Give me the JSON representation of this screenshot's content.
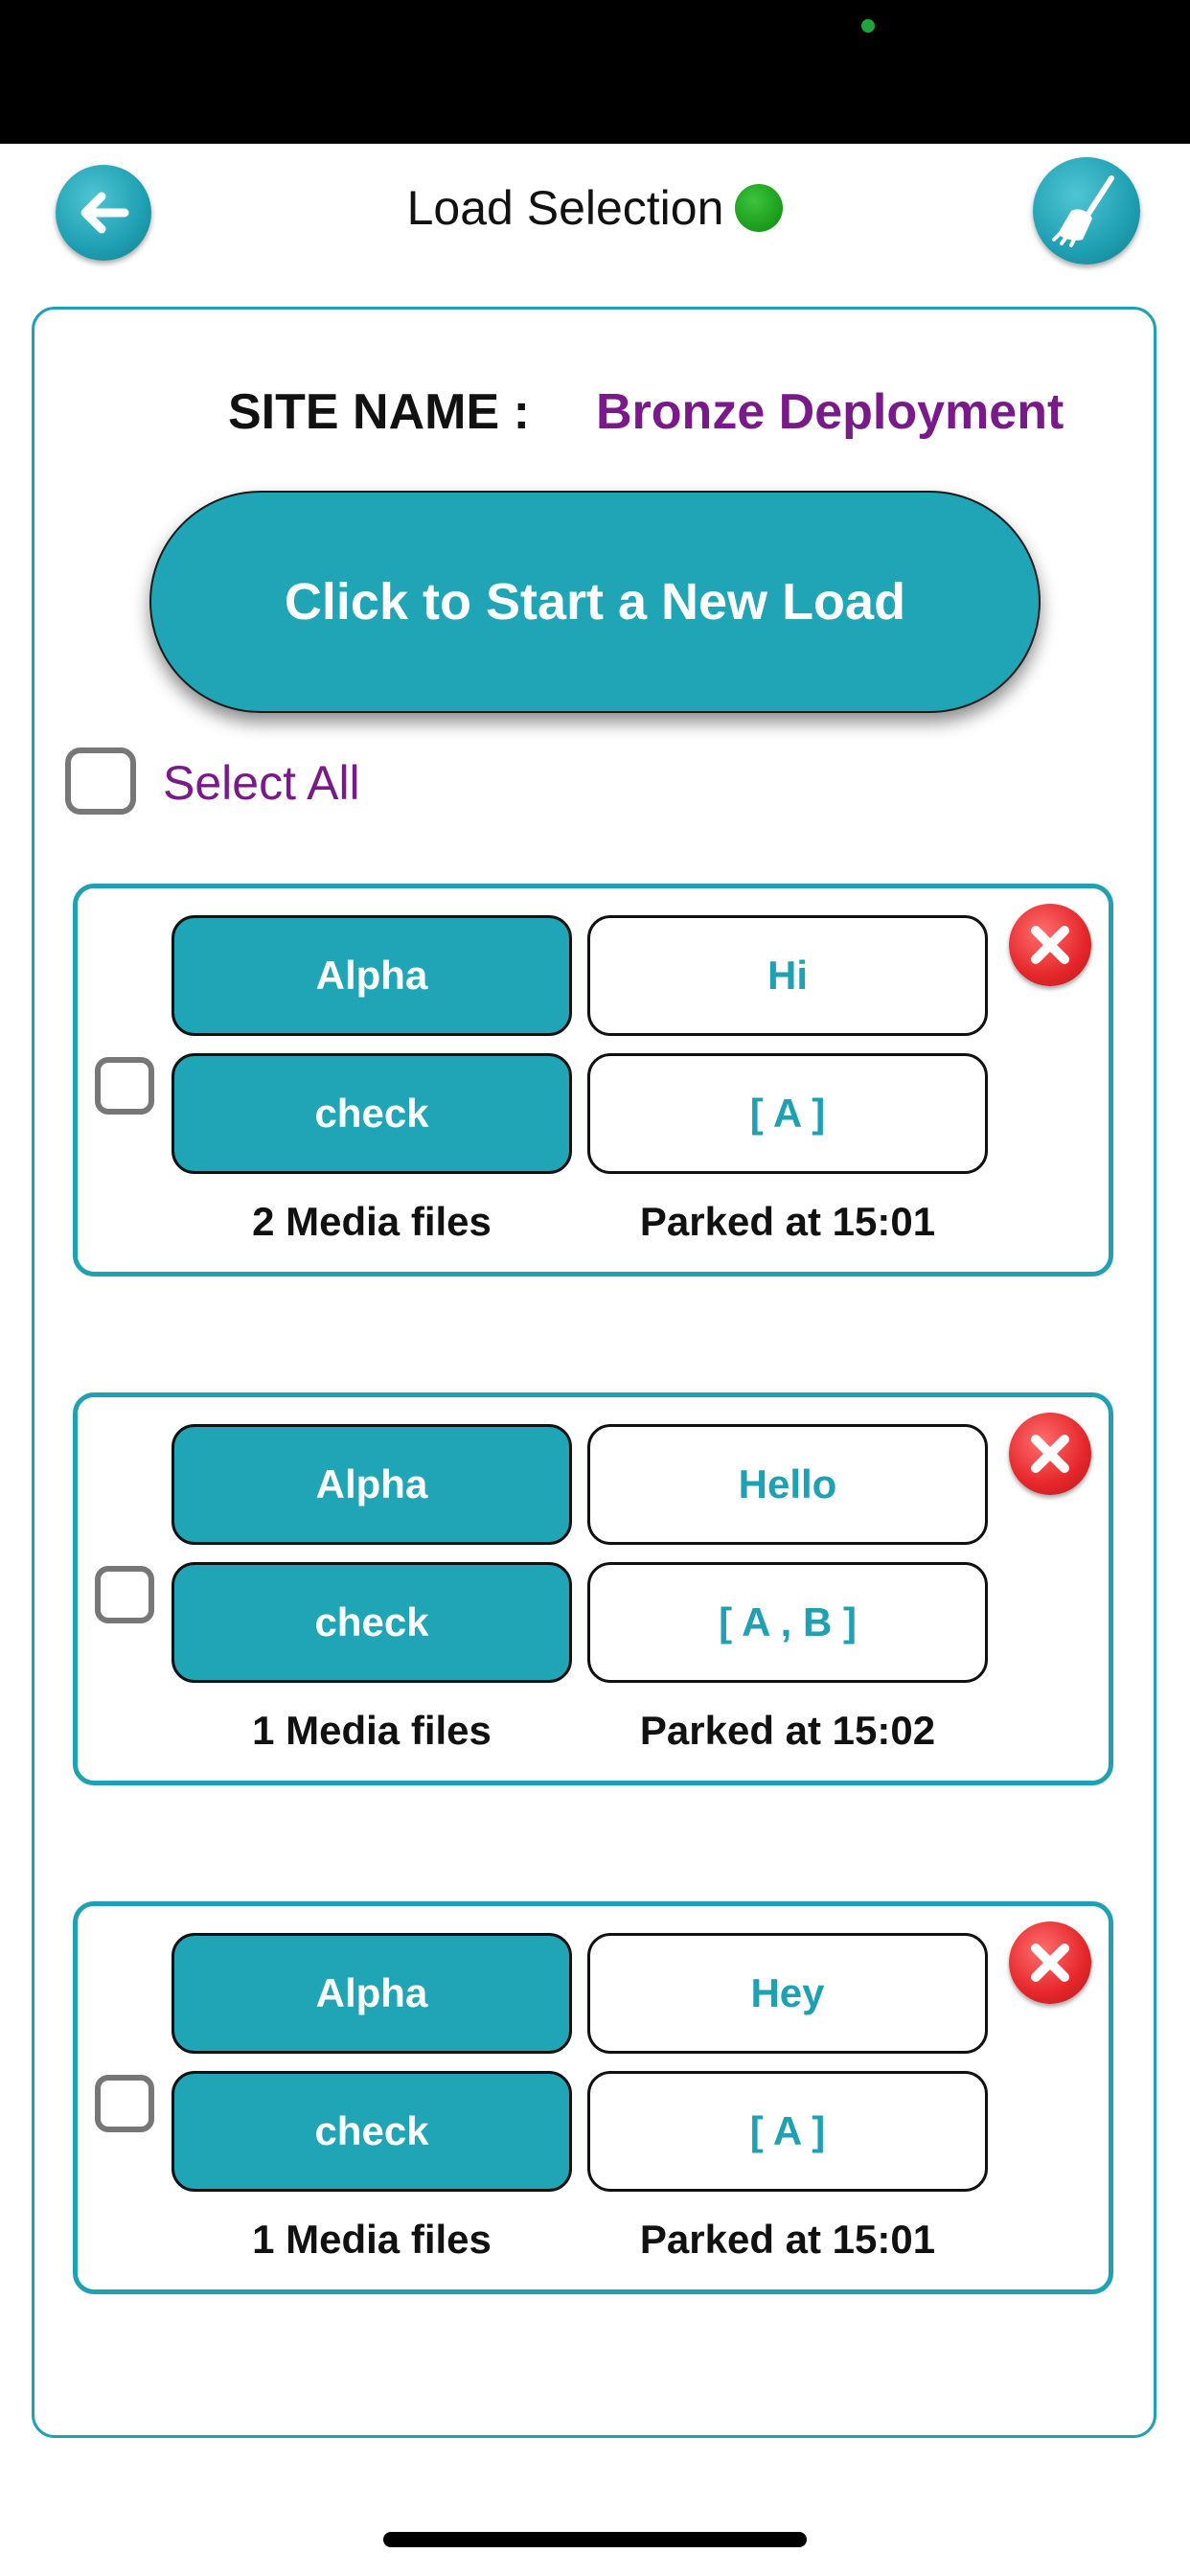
{
  "header": {
    "title": "Load Selection",
    "status_color": "#1a9a1a",
    "back_icon": "back-arrow-icon",
    "clean_icon": "broom-icon"
  },
  "site": {
    "label": "SITE NAME :",
    "value": "Bronze Deployment"
  },
  "new_load": {
    "label": "Click to Start a New Load"
  },
  "select_all": {
    "label": "Select All",
    "checked": false
  },
  "loads": [
    {
      "name": "Alpha",
      "greeting": "Hi",
      "action": "check",
      "tags": "[ A ]",
      "media": "2 Media files",
      "parked": "Parked at 15:01",
      "checked": false
    },
    {
      "name": "Alpha",
      "greeting": "Hello",
      "action": "check",
      "tags": "[ A , B ]",
      "media": "1 Media files",
      "parked": "Parked at 15:02",
      "checked": false
    },
    {
      "name": "Alpha",
      "greeting": "Hey",
      "action": "check",
      "tags": "[ A ]",
      "media": "1 Media files",
      "parked": "Parked at 15:01",
      "checked": false
    }
  ],
  "colors": {
    "accent": "#1fa5b6",
    "site_value": "#7a1a8a",
    "delete": "#e5262a"
  }
}
